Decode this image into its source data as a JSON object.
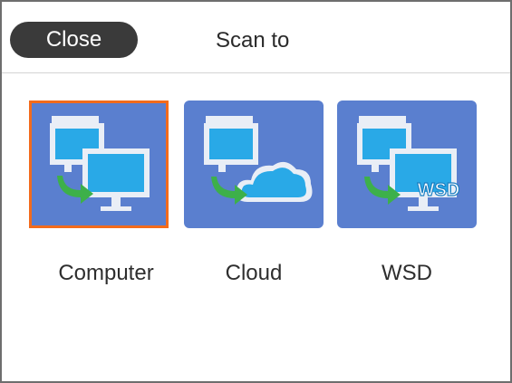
{
  "header": {
    "close_label": "Close",
    "title": "Scan to"
  },
  "options": [
    {
      "label": "Computer",
      "icon": "computer-icon",
      "selected": true
    },
    {
      "label": "Cloud",
      "icon": "cloud-icon",
      "selected": false
    },
    {
      "label": "WSD",
      "icon": "wsd-icon",
      "selected": false,
      "badge": "WSD"
    }
  ],
  "colors": {
    "tile_bg": "#5a7fcf",
    "selected_border": "#f36b1c",
    "close_bg": "#3a3a3a",
    "monitor": "#29a9e7",
    "arrow": "#3db04a"
  }
}
